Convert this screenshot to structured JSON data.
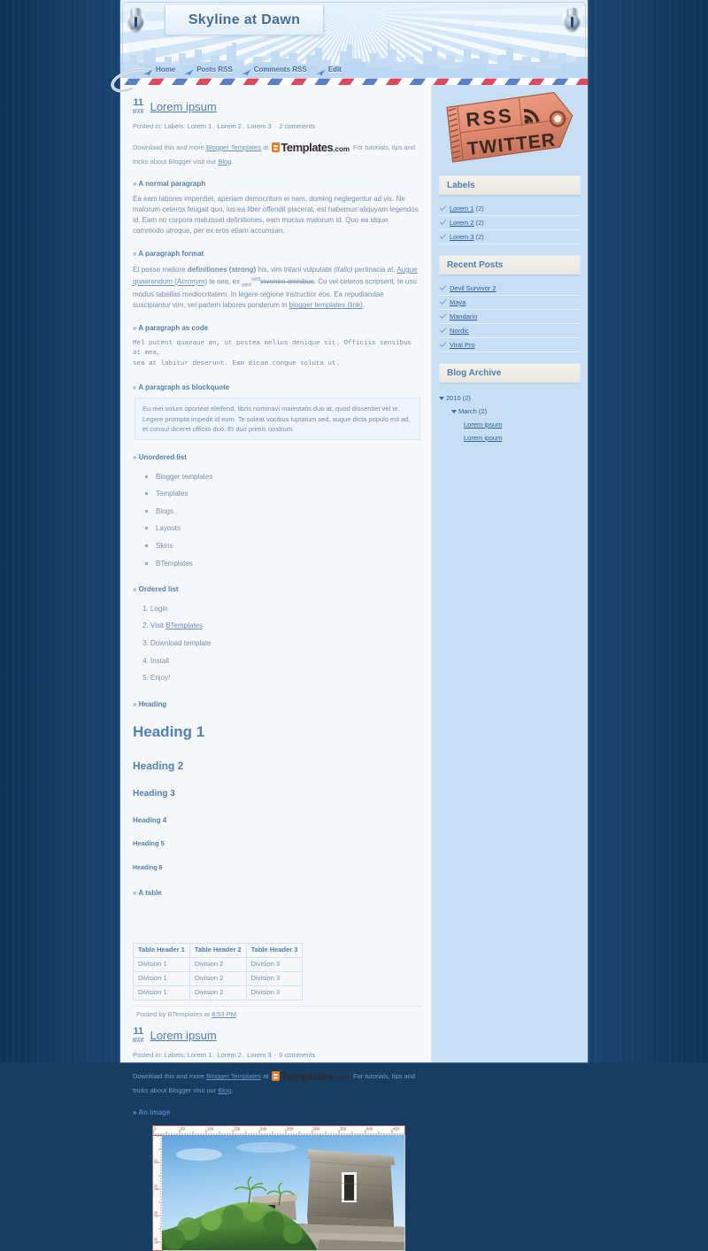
{
  "site": {
    "title": "Skyline at Dawn",
    "background_color": "#173d63",
    "accent_color": "#4a7eb4",
    "sidebar_color": "#c6dff5"
  },
  "nav": {
    "items": [
      {
        "label": "Home"
      },
      {
        "label": "Posts RSS"
      },
      {
        "label": "Comments RSS"
      },
      {
        "label": "Edit"
      }
    ]
  },
  "posts": [
    {
      "day": "11",
      "month": "MAR",
      "title": "Lorem ipsum",
      "meta": {
        "posted_in": "Posted in:",
        "labels_label": "Labels:",
        "labels": [
          "Lorem 1",
          "Lorem 2",
          "Lorem 3"
        ],
        "comments": "2 comments"
      },
      "promo": {
        "pre": "Download this and more",
        "link1": "Blogger Templates",
        "at": "at",
        "logo_b": "Templates",
        "logo_com": ".com",
        "post": "For tutorials, tips and tricks about Blogger visit our",
        "link2": "Blog",
        "period": "."
      },
      "sections": {
        "normal_paragraph": "A normal paragraph",
        "paragraph_format": "A paragraph format",
        "paragraph_as_code": "A paragraph as code",
        "paragraph_as_blockquote": "A paragraph as blockquote",
        "unordered_list": "Unordered list",
        "ordered_list": "Ordered list",
        "heading": "Heading",
        "a_table": "A table"
      },
      "normal_text": "Ea eam labores imperdiet, aperiam democritum ei nam, doming neglegentur ad vis. Ne malorum ceteros feugait quo, ius ea liber offendit placerat, est habemus aliquyam legendos id. Eam no corpora maluisset definitiones, eam mucius malorum id. Quo ea idque commodo utroque, per ex eros etiam accumsan.",
      "format_text": {
        "a": "Et posse meliore ",
        "strong": "definitiones (strong)",
        "b": " his, vim tritani vulputate ",
        "italic": "(italic)",
        "c": " pertinacia at. ",
        "acronym_link": "Augue quaerendum (Acronym)",
        "d": " te sea, ex ",
        "sub": "sed",
        "e": " ",
        "sup": "sint",
        "f": " ",
        "strike": "invenire omnibus",
        "g": ". Cu vel ceteros scripserit, te usu modus tabellas mediocritatem. In legere regione instructior eos. Ea repudiandae suscipiantur vim, vel partem labores ponderum in ",
        "link": "blogger templates (link)",
        "h": "."
      },
      "code_text": "Mel putent quaeque an, ut postea melius denique sit. Officiis sensibus at mea,\nsea at labitur deserunt. Eam dicam congue soluta ut.",
      "blockquote_text": "Eu mei solum oporteat eleifend, libris nominavi maiestatis duo at, quod dissentiet vel te. Legere prompta impedit id eum. Te soleat vocibus luptatum sed, augue dicta populo est ad, et consul diceret officiis duo. Et duo primis nostrum.",
      "unordered_items": [
        "Blogger templates",
        "Templates",
        "Blogs",
        "Layouts",
        "Skins",
        "BTemplates"
      ],
      "ordered_items": [
        {
          "text": "Login",
          "link": ""
        },
        {
          "text": "Visit ",
          "link": "BTemplates"
        },
        {
          "text": "Download template",
          "link": ""
        },
        {
          "text": "Install",
          "link": ""
        },
        {
          "text": "Enjoy!",
          "link": ""
        }
      ],
      "headings": {
        "h1": "Heading 1",
        "h2": "Heading 2",
        "h3": "Heading 3",
        "h4": "Heading 4",
        "h5": "Heading 5",
        "h6": "Heading 6"
      },
      "table": {
        "headers": [
          "Table Header 1",
          "Table Header 2",
          "Table Header 3"
        ],
        "rows": [
          [
            "Division 1",
            "Division 2",
            "Division 3"
          ],
          [
            "Division 1",
            "Division 2",
            "Division 3"
          ],
          [
            "Division 1",
            "Division 2",
            "Division 3"
          ]
        ]
      },
      "footer": {
        "pre": "Posted by BTemplates at",
        "time": "8:53 PM"
      }
    },
    {
      "day": "11",
      "month": "MAR",
      "title": "Lorem ipsum",
      "meta": {
        "posted_in": "Posted in:",
        "labels_label": "Labels:",
        "labels": [
          "Lorem 1",
          "Lorem 2",
          "Lorem 3"
        ],
        "comments": "0 comments"
      },
      "promo": {
        "pre": "Download this and more",
        "link1": "Blogger Templates",
        "at": "at",
        "logo_b": "Templates",
        "logo_com": ".com",
        "post": "For tutorials, tips and tricks about Blogger visit our",
        "link2": "Blog",
        "period": "."
      },
      "image_section": "An image",
      "image": {
        "alt": "Mayan stone temple ruin on a cliff with green vegetation under blue sky",
        "ruler_ticks": [
          "0",
          "50",
          "100",
          "150",
          "200",
          "250",
          "300",
          "350",
          "400",
          "450"
        ],
        "ruler_ticks_v": [
          "50",
          "100",
          "150",
          "200"
        ]
      }
    }
  ],
  "sidebar": {
    "ticket": {
      "line1": "RSS",
      "line2": "TWITTER",
      "icon": "rss-icon",
      "color": "#e08a6f"
    },
    "widgets": [
      {
        "title": "Labels",
        "items": [
          {
            "label": "Lorem 1",
            "count": "(2)"
          },
          {
            "label": "Lorem 2",
            "count": "(2)"
          },
          {
            "label": "Lorem 3",
            "count": "(2)"
          }
        ]
      },
      {
        "title": "Recent Posts",
        "items": [
          {
            "label": "Devil Survivor 2",
            "count": ""
          },
          {
            "label": "Maya",
            "count": ""
          },
          {
            "label": "Mandarin",
            "count": ""
          },
          {
            "label": "Nordic",
            "count": ""
          },
          {
            "label": "Viral Pro",
            "count": ""
          }
        ]
      }
    ],
    "archive": {
      "title": "Blog Archive",
      "year": "2010 (2)",
      "month": "March (2)",
      "posts": [
        "Lorem ipsum",
        "Lorem ipsum"
      ]
    }
  }
}
